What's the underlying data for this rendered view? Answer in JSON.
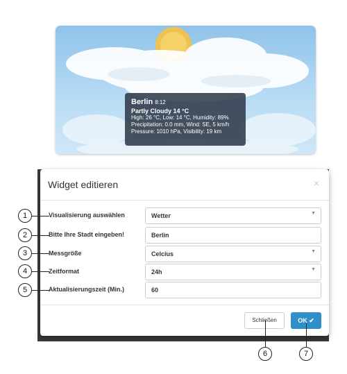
{
  "weather": {
    "city": "Berlin",
    "time": "8:12",
    "condition": "Partly Cloudy 14 °C",
    "line1": "High: 26 °C, Low: 14 °C, Humidity: 89%",
    "line2": "Precipitation: 0.0 mm, Wind: SE, 5 km/h",
    "line3": "Pressure: 1010 hPa, Visibility: 19 km",
    "icon": "partly-cloudy-sun"
  },
  "modal": {
    "title": "Widget editieren",
    "close_glyph": "×",
    "fields": [
      {
        "label": "Visualisierung auswählen",
        "value": "Wetter",
        "type": "select"
      },
      {
        "label": "Bitte Ihre Stadt eingeben!",
        "value": "Berlin",
        "type": "text"
      },
      {
        "label": "Messgröße",
        "value": "Celcius",
        "type": "select"
      },
      {
        "label": "Zeitformat",
        "value": "24h",
        "type": "select"
      },
      {
        "label": "Aktualisierungszeit (Min.)",
        "value": "60",
        "type": "text"
      }
    ],
    "close_button": "Schließen",
    "ok_button": "OK",
    "ok_icon": "✔"
  },
  "callouts": [
    "1",
    "2",
    "3",
    "4",
    "5",
    "6",
    "7"
  ],
  "colors": {
    "primary": "#2f8fc8",
    "overlay": "#2d3746",
    "sky": "#8fc3ea"
  }
}
